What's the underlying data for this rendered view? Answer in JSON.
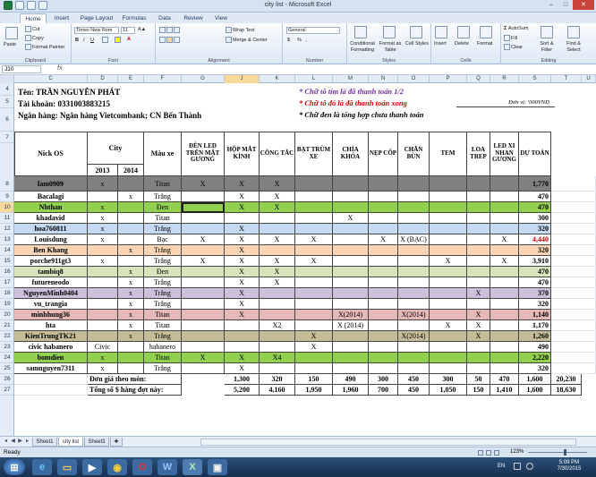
{
  "window": {
    "title": "city list - Microsoft Excel",
    "minimize": "–",
    "maximize": "□",
    "close": "✕"
  },
  "tabs": [
    "Home",
    "Insert",
    "Page Layout",
    "Formulas",
    "Data",
    "Review",
    "View"
  ],
  "ribbon": {
    "clipboard": {
      "label": "Clipboard",
      "paste": "Paste",
      "cut": "Cut",
      "copy": "Copy",
      "format_painter": "Format Painter"
    },
    "font": {
      "label": "Font",
      "name": "Times New Rom",
      "size": "11",
      "bold": "B",
      "italic": "I",
      "underline": "U"
    },
    "alignment": {
      "label": "Alignment",
      "wrap": "Wrap Text",
      "merge": "Merge & Center"
    },
    "number": {
      "label": "Number",
      "format": "General",
      "currency": "$",
      "percent": "%",
      "comma": ","
    },
    "styles": {
      "label": "Styles",
      "conditional": "Conditional Formatting",
      "format_table": "Format as Table",
      "cell_styles": "Cell Styles"
    },
    "cells": {
      "label": "Cells",
      "insert": "Insert",
      "delete": "Delete",
      "format": "Format"
    },
    "editing": {
      "label": "Editing",
      "autosum": "AutoSum",
      "fill": "Fill",
      "clear": "Clear",
      "sort": "Sort & Filter",
      "find": "Find & Select"
    }
  },
  "formula_bar": {
    "name_box": "J10",
    "fx": "fx",
    "value": ""
  },
  "columns": [
    "C",
    "D",
    "E",
    "F",
    "G",
    "J",
    "K",
    "L",
    "M",
    "N",
    "O",
    "P",
    "Q",
    "R",
    "S",
    "T",
    "U"
  ],
  "info": {
    "name": "Tên: TRẦN NGUYÊN PHÁT",
    "account": "Tài khoản: 0331003883215",
    "bank": "Ngân hàng: Ngân hàng Vietcombank; CN Bến Thành",
    "unit": "Đơn vị: '000VND"
  },
  "legend": [
    {
      "text": "* Chữ tô tím là đã thanh toán 1/2",
      "color": "#7030a0"
    },
    {
      "text": "* Chữ tô đỏ là đã thanh toán xong",
      "color": "#d00000"
    },
    {
      "text": "* Chữ đen là tổng hợp chưa thanh toán",
      "color": "#000000"
    }
  ],
  "headers": {
    "nick": "Nick OS",
    "city": "City",
    "y2013": "2013",
    "y2014": "2014",
    "color": "Màu xe",
    "items": [
      "ĐÈN LED TRÊN MẶT GƯƠNG",
      "HỘP MẮT KÍNH",
      "CÔNG TẮC",
      "BẠT TRÙM XE",
      "CHÌA KHÓA",
      "NẸP CỐP",
      "CHẮN BÙN",
      "TEM",
      "LOA TREP",
      "LED XI NHAN GƯƠNG",
      "DỰ TOÁN"
    ]
  },
  "rows": [
    {
      "n": "8",
      "nick": "lam0909",
      "c13": "x",
      "c14": "",
      "color": "Titan",
      "v": [
        "X",
        "X",
        "X",
        "",
        "",
        "",
        "",
        "",
        "",
        "",
        ""
      ],
      "total": "1,770",
      "bg": "#808080",
      "h": 17
    },
    {
      "n": "9",
      "nick": "Bacalagi",
      "c13": "",
      "c14": "x",
      "color": "Trắng",
      "v": [
        "",
        "X",
        "X",
        "",
        "",
        "",
        "",
        "",
        "",
        "",
        ""
      ],
      "total": "470",
      "bg": "#ffffff",
      "h": 12
    },
    {
      "n": "10",
      "nick": "Nhthan",
      "c13": "x",
      "c14": "",
      "color": "Đen",
      "v": [
        "",
        "X",
        "X",
        "",
        "",
        "",
        "",
        "",
        "",
        "",
        ""
      ],
      "total": "470",
      "bg": "#92d050",
      "h": 12
    },
    {
      "n": "11",
      "nick": "khadavid",
      "c13": "x",
      "c14": "",
      "color": "Titan",
      "v": [
        "",
        "",
        "",
        "",
        "X",
        "",
        "",
        "",
        "",
        "",
        ""
      ],
      "total": "300",
      "bg": "#ffffff",
      "h": 12
    },
    {
      "n": "12",
      "nick": "hoa760811",
      "c13": "x",
      "c14": "",
      "color": "Trắng",
      "v": [
        "",
        "X",
        "",
        "",
        "",
        "",
        "",
        "",
        "",
        "",
        ""
      ],
      "total": "320",
      "bg": "#c5d9f1",
      "h": 12
    },
    {
      "n": "13",
      "nick": "Louisdung",
      "c13": "x",
      "c14": "",
      "color": "Bạc",
      "v": [
        "X",
        "X",
        "X",
        "X",
        "",
        "X",
        "X (BẠC)",
        "",
        "",
        "X",
        ""
      ],
      "total": "4,440",
      "bg": "#ffffff",
      "h": 12,
      "red": true
    },
    {
      "n": "14",
      "nick": "Ben Khang",
      "c13": "",
      "c14": "x",
      "color": "Trắng",
      "v": [
        "",
        "X",
        "",
        "",
        "",
        "",
        "",
        "",
        "",
        "",
        ""
      ],
      "total": "320",
      "bg": "#fbd5b5",
      "h": 12
    },
    {
      "n": "15",
      "nick": "porche911gt3",
      "c13": "x",
      "c14": "",
      "color": "Trắng",
      "v": [
        "X",
        "X",
        "X",
        "X",
        "",
        "",
        "",
        "X",
        "",
        "X",
        ""
      ],
      "total": "3,910",
      "bg": "#ffffff",
      "h": 12
    },
    {
      "n": "16",
      "nick": "tambiq8",
      "c13": "",
      "c14": "x",
      "color": "Đen",
      "v": [
        "",
        "X",
        "X",
        "",
        "",
        "",
        "",
        "",
        "",
        "",
        ""
      ],
      "total": "470",
      "bg": "#d8e4bc",
      "h": 12
    },
    {
      "n": "17",
      "nick": "futureneodo",
      "c13": "",
      "c14": "x",
      "color": "Trắng",
      "v": [
        "",
        "X",
        "X",
        "",
        "",
        "",
        "",
        "",
        "",
        "",
        ""
      ],
      "total": "470",
      "bg": "#ffffff",
      "h": 12
    },
    {
      "n": "18",
      "nick": "NguyenMinh0404",
      "c13": "",
      "c14": "x",
      "color": "Trắng",
      "v": [
        "",
        "X",
        "",
        "",
        "",
        "",
        "",
        "",
        "X",
        "",
        ""
      ],
      "total": "370",
      "bg": "#ccc0da",
      "h": 12
    },
    {
      "n": "19",
      "nick": "vu_trangia",
      "c13": "",
      "c14": "x",
      "color": "Trắng",
      "v": [
        "",
        "X",
        "",
        "",
        "",
        "",
        "",
        "",
        "",
        "",
        ""
      ],
      "total": "320",
      "bg": "#ffffff",
      "h": 12
    },
    {
      "n": "20",
      "nick": "minhhung36",
      "c13": "",
      "c14": "x",
      "color": "Titan",
      "v": [
        "",
        "X",
        "",
        "",
        "X(2014)",
        "",
        "X(2014)",
        "",
        "X",
        "",
        ""
      ],
      "total": "1,140",
      "bg": "#e6b8b7",
      "h": 12
    },
    {
      "n": "21",
      "nick": "hta",
      "c13": "",
      "c14": "x",
      "color": "Titan",
      "v": [
        "",
        "",
        "X2",
        "",
        "X (2014)",
        "",
        "",
        "X",
        "X",
        "",
        ""
      ],
      "total": "1,170",
      "bg": "#ffffff",
      "h": 12
    },
    {
      "n": "22",
      "nick": "KienTrungTK21",
      "c13": "",
      "c14": "x",
      "color": "Trắng",
      "v": [
        "",
        "",
        "",
        "X",
        "",
        "",
        "X(2014)",
        "",
        "X",
        "",
        ""
      ],
      "total": "1,260",
      "bg": "#c4bd97",
      "h": 12
    },
    {
      "n": "23",
      "nick": "civic habanero",
      "c13": "Civic",
      "c14": "",
      "color": "habanero",
      "v": [
        "",
        "",
        "",
        "X",
        "",
        "",
        "",
        "",
        "",
        "",
        ""
      ],
      "total": "490",
      "bg": "#ffffff",
      "h": 12
    },
    {
      "n": "24",
      "nick": "bomdien",
      "c13": "x",
      "c14": "",
      "color": "Titan",
      "v": [
        "X",
        "X",
        "X4",
        "",
        "",
        "",
        "",
        "",
        "",
        "",
        ""
      ],
      "total": "2,220",
      "bg": "#92d050",
      "h": 12
    },
    {
      "n": "25",
      "nick": "samnguyen7311",
      "c13": "x",
      "c14": "",
      "color": "Trắng",
      "v": [
        "",
        "X",
        "",
        "",
        "",
        "",
        "",
        "",
        "",
        "",
        ""
      ],
      "total": "320",
      "bg": "#ffffff",
      "h": 12
    }
  ],
  "price_row": {
    "n": "26",
    "label": "Đơn giá theo món:",
    "v": [
      "1,300",
      "320",
      "150",
      "490",
      "300",
      "450",
      "300",
      "50",
      "470",
      "1,600",
      "20,230"
    ]
  },
  "total_row": {
    "n": "27",
    "label": "Tổng số $ hàng đợt này:",
    "v": [
      "5,200",
      "4,160",
      "1,950",
      "1,960",
      "700",
      "450",
      "1,050",
      "150",
      "1,410",
      "1,600",
      "18,630"
    ]
  },
  "sheets": [
    "Sheet1",
    "city list",
    "Sheet3"
  ],
  "status": {
    "ready": "Ready",
    "zoom": "123%"
  },
  "taskbar": {
    "lang": "EN",
    "time": "5:09 PM",
    "date": "7/30/2015"
  }
}
